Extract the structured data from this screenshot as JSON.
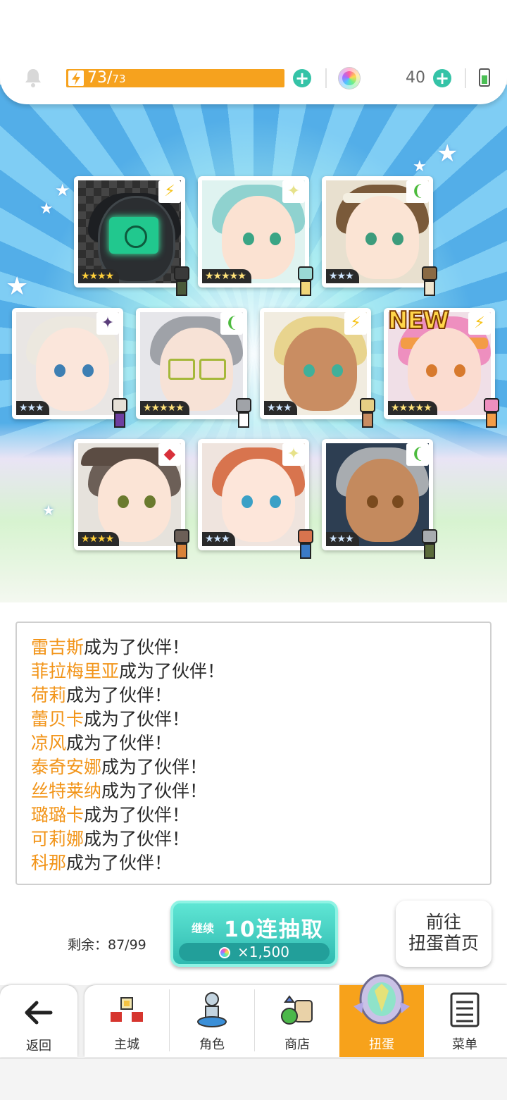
{
  "status": {
    "energy_value": "73",
    "energy_max": "73",
    "gem_count": "40"
  },
  "cards": [
    {
      "attr": "lightning",
      "attr_symbol": "⚡",
      "rarity": 4
    },
    {
      "attr": "light",
      "attr_symbol": "✦",
      "rarity": 5
    },
    {
      "attr": "wind",
      "attr_symbol": "❨",
      "rarity": 3
    },
    {
      "attr": "dark",
      "attr_symbol": "✦",
      "rarity": 3
    },
    {
      "attr": "wind",
      "attr_symbol": "❨",
      "rarity": 5
    },
    {
      "attr": "lightning",
      "attr_symbol": "⚡",
      "rarity": 3
    },
    {
      "attr": "lightning",
      "attr_symbol": "⚡",
      "rarity": 5,
      "badge": "NEW"
    },
    {
      "attr": "fire",
      "attr_symbol": "◆",
      "rarity": 4
    },
    {
      "attr": "light",
      "attr_symbol": "✦",
      "rarity": 3
    },
    {
      "attr": "wind",
      "attr_symbol": "❨",
      "rarity": 3
    }
  ],
  "messages": {
    "suffix": "成为了伙伴！",
    "names": [
      "雷吉斯",
      "菲拉梅里亚",
      "荷莉",
      "蕾贝卡",
      "凉风",
      "泰奇安娜",
      "丝特莱纳",
      "璐璐卡",
      "可莉娜",
      "科那"
    ]
  },
  "actions": {
    "remaining_label": "剩余：87/99",
    "continue_label": "继续",
    "continue_title": "10连抽取",
    "continue_cost": "×1,500",
    "home_line1": "前往",
    "home_line2": "扭蛋首页"
  },
  "nav": {
    "back": "返回",
    "items": [
      "主城",
      "角色",
      "商店",
      "扭蛋",
      "菜单"
    ],
    "active": "扭蛋"
  },
  "colors": {
    "accent": "#f7a21b",
    "teal": "#35c3a7",
    "name_highlight": "#f29418"
  }
}
